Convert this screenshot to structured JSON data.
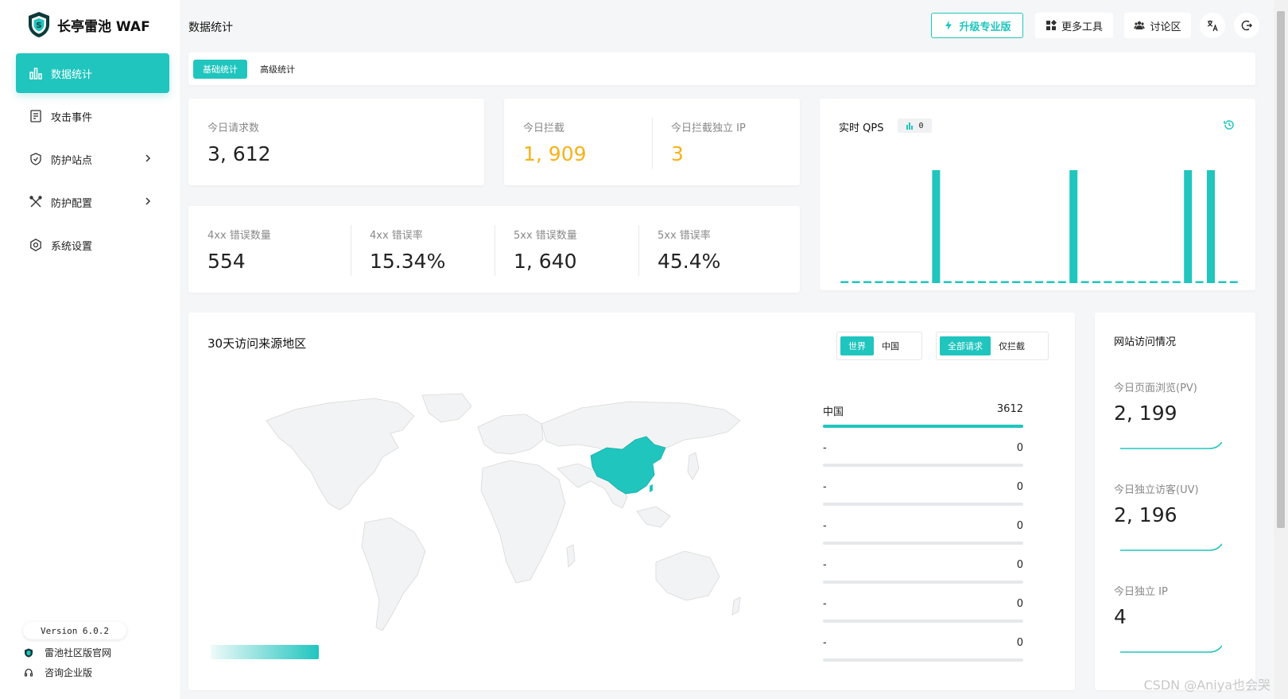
{
  "app": {
    "name": "长亭雷池 WAF"
  },
  "sidebar": {
    "items": [
      {
        "label": "数据统计",
        "icon": "bar-chart-icon",
        "active": true
      },
      {
        "label": "攻击事件",
        "icon": "document-icon"
      },
      {
        "label": "防护站点",
        "icon": "shield-icon",
        "has_submenu": true
      },
      {
        "label": "防护配置",
        "icon": "tools-icon",
        "has_submenu": true
      },
      {
        "label": "系统设置",
        "icon": "gear-icon"
      }
    ],
    "version": "Version 6.0.2",
    "links": [
      {
        "label": "雷池社区版官网",
        "icon": "shield-icon"
      },
      {
        "label": "咨询企业版",
        "icon": "headset-icon"
      }
    ]
  },
  "header": {
    "title": "数据统计",
    "upgrade_label": "升级专业版",
    "tools_label": "更多工具",
    "forum_label": "讨论区"
  },
  "tabs": [
    {
      "label": "基础统计",
      "active": true
    },
    {
      "label": "高级统计"
    }
  ],
  "stats": {
    "requests": {
      "label": "今日请求数",
      "value": "3, 612"
    },
    "blocked": {
      "label": "今日拦截",
      "value": "1, 909"
    },
    "blocked_ip": {
      "label": "今日拦截独立 IP",
      "value": "3"
    },
    "err4xx_count": {
      "label": "4xx 错误数量",
      "value": "554"
    },
    "err4xx_rate": {
      "label": "4xx 错误率",
      "value": "15.34%"
    },
    "err5xx_count": {
      "label": "5xx 错误数量",
      "value": "1, 640"
    },
    "err5xx_rate": {
      "label": "5xx 错误率",
      "value": "45.4%"
    }
  },
  "qps": {
    "title": "实时 QPS",
    "current": "0"
  },
  "chart_data": {
    "type": "bar",
    "title": "实时 QPS",
    "values": [
      0,
      0,
      0,
      0,
      0,
      0,
      0,
      0,
      1,
      0,
      0,
      0,
      0,
      0,
      0,
      0,
      0,
      0,
      0,
      0,
      1,
      0,
      0,
      0,
      0,
      0,
      0,
      0,
      0,
      0,
      1,
      0,
      1,
      0,
      0
    ],
    "ylim": [
      0,
      1
    ],
    "grid": false
  },
  "map": {
    "title": "30天访问来源地区",
    "scope_options": [
      "世界",
      "中国"
    ],
    "scope_selected": "世界",
    "filter_options": [
      "全部请求",
      "仅拦截"
    ],
    "filter_selected": "全部请求",
    "highlight_color": "#20c5be",
    "ranking": [
      {
        "name": "中国",
        "value": "3612",
        "fraction": 1.0
      },
      {
        "name": "-",
        "value": "0",
        "fraction": 0
      },
      {
        "name": "-",
        "value": "0",
        "fraction": 0
      },
      {
        "name": "-",
        "value": "0",
        "fraction": 0
      },
      {
        "name": "-",
        "value": "0",
        "fraction": 0
      },
      {
        "name": "-",
        "value": "0",
        "fraction": 0
      },
      {
        "name": "-",
        "value": "0",
        "fraction": 0
      }
    ]
  },
  "site_visit": {
    "title": "网站访问情况",
    "pv": {
      "label": "今日页面浏览(PV)",
      "value": "2, 199"
    },
    "uv": {
      "label": "今日独立访客(UV)",
      "value": "2, 196"
    },
    "ip": {
      "label": "今日独立 IP",
      "value": "4"
    }
  },
  "watermark": "CSDN @Aniya也会哭",
  "colors": {
    "accent": "#20c5be",
    "orange": "#f6b21a"
  }
}
